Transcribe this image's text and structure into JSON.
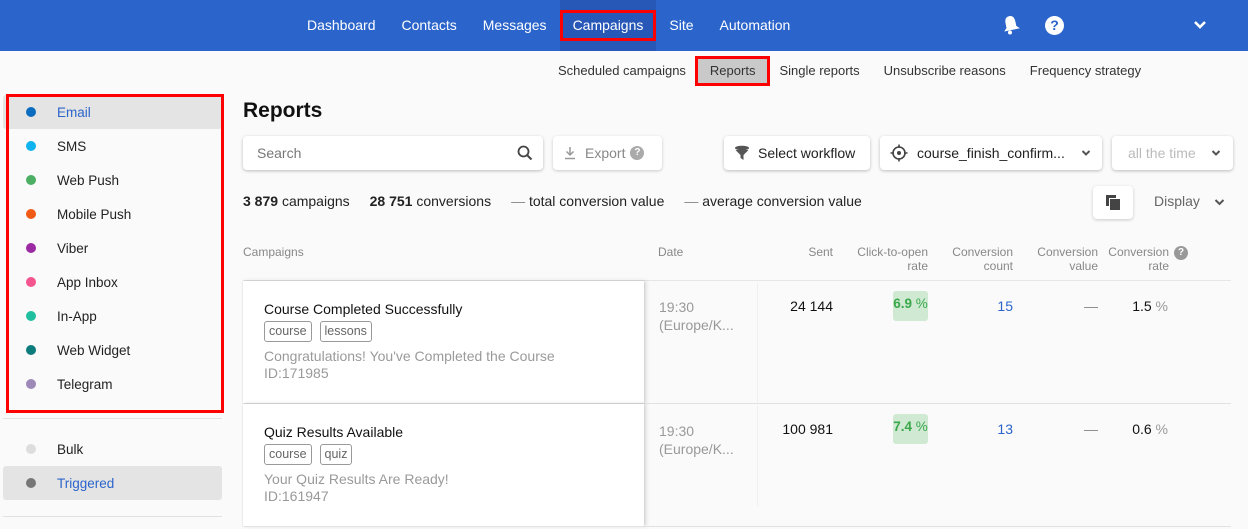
{
  "topnav": {
    "items": [
      "Dashboard",
      "Contacts",
      "Messages",
      "Campaigns",
      "Site",
      "Automation"
    ],
    "active": "Campaigns",
    "icons": {
      "notifications": "bell-icon",
      "help": "help-icon",
      "account_menu": "chevron-down-icon"
    },
    "help_glyph": "?"
  },
  "subnav": {
    "items": [
      "Scheduled campaigns",
      "Reports",
      "Single reports",
      "Unsubscribe reasons",
      "Frequency strategy"
    ],
    "active": "Reports"
  },
  "sidebar": {
    "channels": [
      {
        "label": "Email",
        "color": "#0b6dbf",
        "active": true
      },
      {
        "label": "SMS",
        "color": "#0fb3ef",
        "active": false
      },
      {
        "label": "Web Push",
        "color": "#4caf63",
        "active": false
      },
      {
        "label": "Mobile Push",
        "color": "#f05a14",
        "active": false
      },
      {
        "label": "Viber",
        "color": "#9c2aa3",
        "active": false
      },
      {
        "label": "App Inbox",
        "color": "#f5558f",
        "active": false
      },
      {
        "label": "In-App",
        "color": "#1fbf9f",
        "active": false
      },
      {
        "label": "Web Widget",
        "color": "#0c7b7b",
        "active": false
      },
      {
        "label": "Telegram",
        "color": "#9d8ab8",
        "active": false
      }
    ],
    "types": [
      {
        "label": "Bulk",
        "color": "#dddddd",
        "active": false
      },
      {
        "label": "Triggered",
        "color": "#777777",
        "active": true
      }
    ]
  },
  "main": {
    "title": "Reports",
    "search_placeholder": "Search",
    "export_label": "Export",
    "export_help": "?",
    "workflow_label": "Select workflow",
    "goal_value": "course_finish_confirm...",
    "period_value": "all the time",
    "summary": {
      "campaigns_count": "3 879",
      "campaigns_label": "campaigns",
      "conversions_count": "28 751",
      "conversions_label": "conversions",
      "total_value": "—",
      "total_label": "total conversion value",
      "avg_value": "—",
      "avg_label": "average conversion value"
    },
    "display_label": "Display"
  },
  "table": {
    "columns": {
      "campaigns": "Campaigns",
      "date": "Date",
      "sent": "Sent",
      "ctor_1": "Click-to-open",
      "ctor_2": "rate",
      "cc_1": "Conversion",
      "cc_2": "count",
      "cv_1": "Conversion",
      "cv_2": "value",
      "cr_1": "Conversion",
      "cr_2": "rate"
    },
    "rows": [
      {
        "title": "Course Completed Successfully",
        "tags": [
          "course",
          "lessons"
        ],
        "subject": "Congratulations! You've Completed the Course",
        "id": "ID:171985",
        "time": "19:30",
        "tz": "(Europe/K...",
        "sent": "24 144",
        "ctor": "6.9",
        "conv_count": "15",
        "conv_value": "—",
        "conv_rate": "1.5"
      },
      {
        "title": "Quiz Results Available",
        "tags": [
          "course",
          "quiz"
        ],
        "subject": "Your Quiz Results Are Ready!",
        "id": "ID:161947",
        "time": "19:30",
        "tz": "(Europe/K...",
        "sent": "100 981",
        "ctor": "7.4",
        "conv_count": "13",
        "conv_value": "—",
        "conv_rate": "0.6"
      }
    ],
    "pct": "%"
  }
}
